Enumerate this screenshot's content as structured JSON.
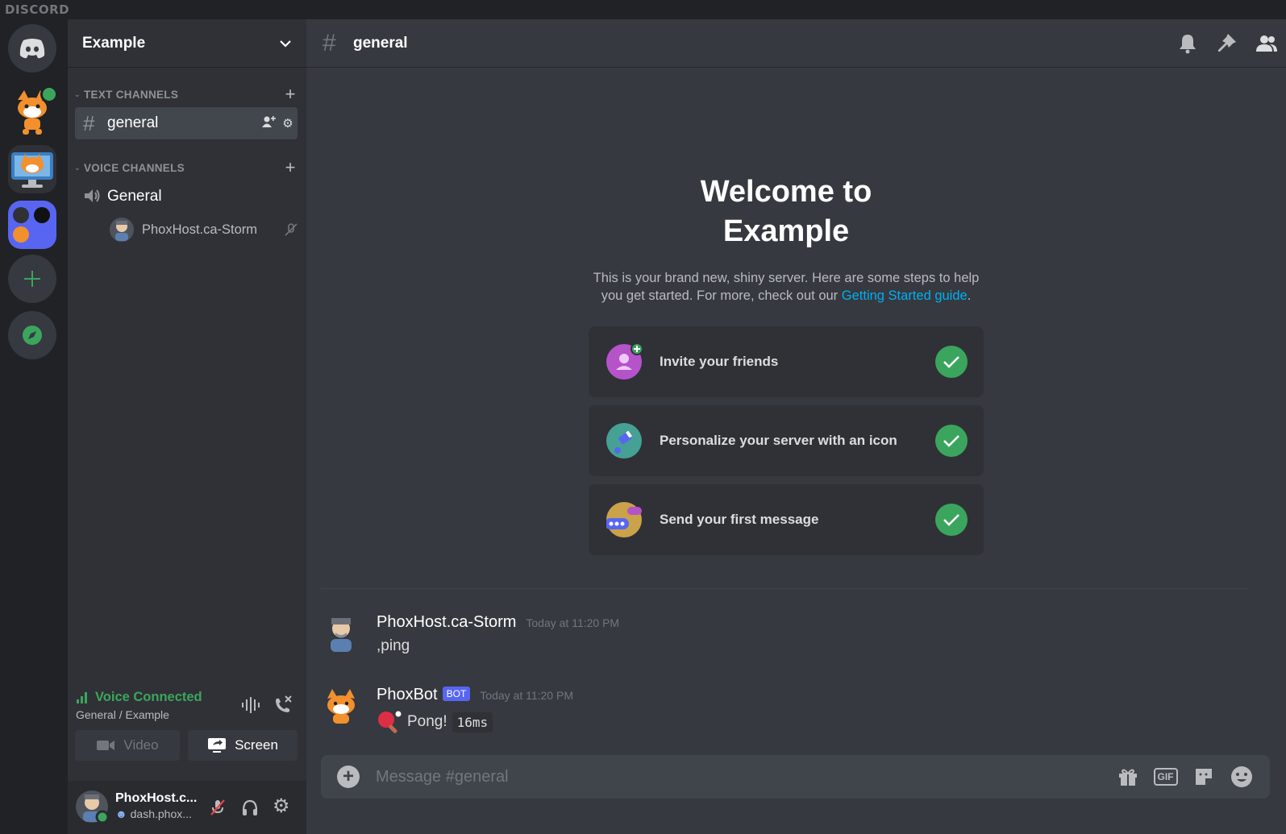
{
  "app": {
    "brand": "DISCORD"
  },
  "colors": {
    "accent": "#5865f2",
    "online": "#3ba55d",
    "link": "#00aff4"
  },
  "server": {
    "name": "Example"
  },
  "sidebar": {
    "categories": [
      {
        "label": "TEXT CHANNELS"
      },
      {
        "label": "VOICE CHANNELS"
      }
    ],
    "text_channels": [
      {
        "name": "general",
        "icon": "hash-icon",
        "active": true
      }
    ],
    "voice_channels": [
      {
        "name": "General",
        "icon": "speaker-icon",
        "users": [
          {
            "name": "PhoxHost.ca-Storm"
          }
        ]
      }
    ]
  },
  "voice_panel": {
    "status": "Voice Connected",
    "location": "General / Example",
    "video_label": "Video",
    "screen_label": "Screen"
  },
  "user_panel": {
    "username": "PhoxHost.c...",
    "status": "dash.phox..."
  },
  "header": {
    "channel": "general"
  },
  "welcome": {
    "title_line1": "Welcome to",
    "title_line2": "Example",
    "text_line1": "This is your brand new, shiny server. Here are some steps to help",
    "text_line2": "you get started. For more, check out our ",
    "link": "Getting Started guide",
    "after_link": ".",
    "steps": [
      {
        "label": "Invite your friends",
        "done": true
      },
      {
        "label": "Personalize your server with an icon",
        "done": true
      },
      {
        "label": "Send your first message",
        "done": true
      }
    ]
  },
  "messages": [
    {
      "author": "PhoxHost.ca-Storm",
      "time": "Today at 11:20 PM",
      "content": ",ping"
    },
    {
      "author": "PhoxBot",
      "badge": "BOT",
      "time": "Today at 11:20 PM",
      "emoji": "ping-pong-icon",
      "content": "Pong!",
      "code": "16ms"
    }
  ],
  "composer": {
    "placeholder": "Message #general",
    "gif_label": "GIF"
  }
}
